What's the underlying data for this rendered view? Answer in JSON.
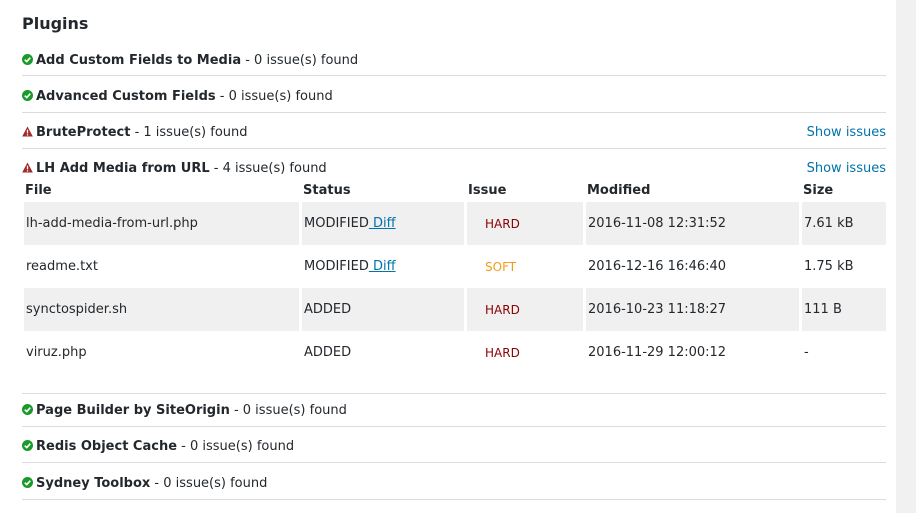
{
  "title": "Plugins",
  "colors": {
    "ok": "#1a9a2a",
    "warn": "#a32a2a",
    "link": "#0073aa",
    "hard": "#8b0000",
    "soft": "#f39c12"
  },
  "plugins": [
    {
      "name": "Add Custom Fields to Media",
      "summary": " - 0 issue(s) found",
      "status_icon": "check-circle-icon"
    },
    {
      "name": "Advanced Custom Fields",
      "summary": " - 0 issue(s) found",
      "status_icon": "check-circle-icon"
    },
    {
      "name": "BruteProtect",
      "summary": " - 1 issue(s) found",
      "status_icon": "warning-icon",
      "action": "Show issues"
    },
    {
      "name": "LH Add Media from URL",
      "summary": " - 4 issue(s) found",
      "status_icon": "warning-icon",
      "action": "Show issues"
    },
    {
      "name": "Page Builder by SiteOrigin",
      "summary": " - 0 issue(s) found",
      "status_icon": "check-circle-icon"
    },
    {
      "name": "Redis Object Cache",
      "summary": " - 0 issue(s) found",
      "status_icon": "check-circle-icon"
    },
    {
      "name": "Sydney Toolbox",
      "summary": " - 0 issue(s) found",
      "status_icon": "check-circle-icon"
    }
  ],
  "issues_table": {
    "headers": [
      "File",
      "Status",
      "Issue",
      "Modified",
      "Size"
    ],
    "rows": [
      {
        "file": "lh-add-media-from-url.php",
        "status": "MODIFIED",
        "diff": " Diff",
        "issue": "HARD",
        "modified": "2016-11-08 12:31:52",
        "size": "7.61 kB"
      },
      {
        "file": "readme.txt",
        "status": "MODIFIED",
        "diff": " Diff",
        "issue": "SOFT",
        "modified": "2016-12-16 16:46:40",
        "size": "1.75 kB"
      },
      {
        "file": "synctospider.sh",
        "status": "ADDED",
        "diff": "",
        "issue": "HARD",
        "modified": "2016-10-23 11:18:27",
        "size": "111 B"
      },
      {
        "file": "viruz.php",
        "status": "ADDED",
        "diff": "",
        "issue": "HARD",
        "modified": "2016-11-29 12:00:12",
        "size": "-"
      }
    ]
  }
}
